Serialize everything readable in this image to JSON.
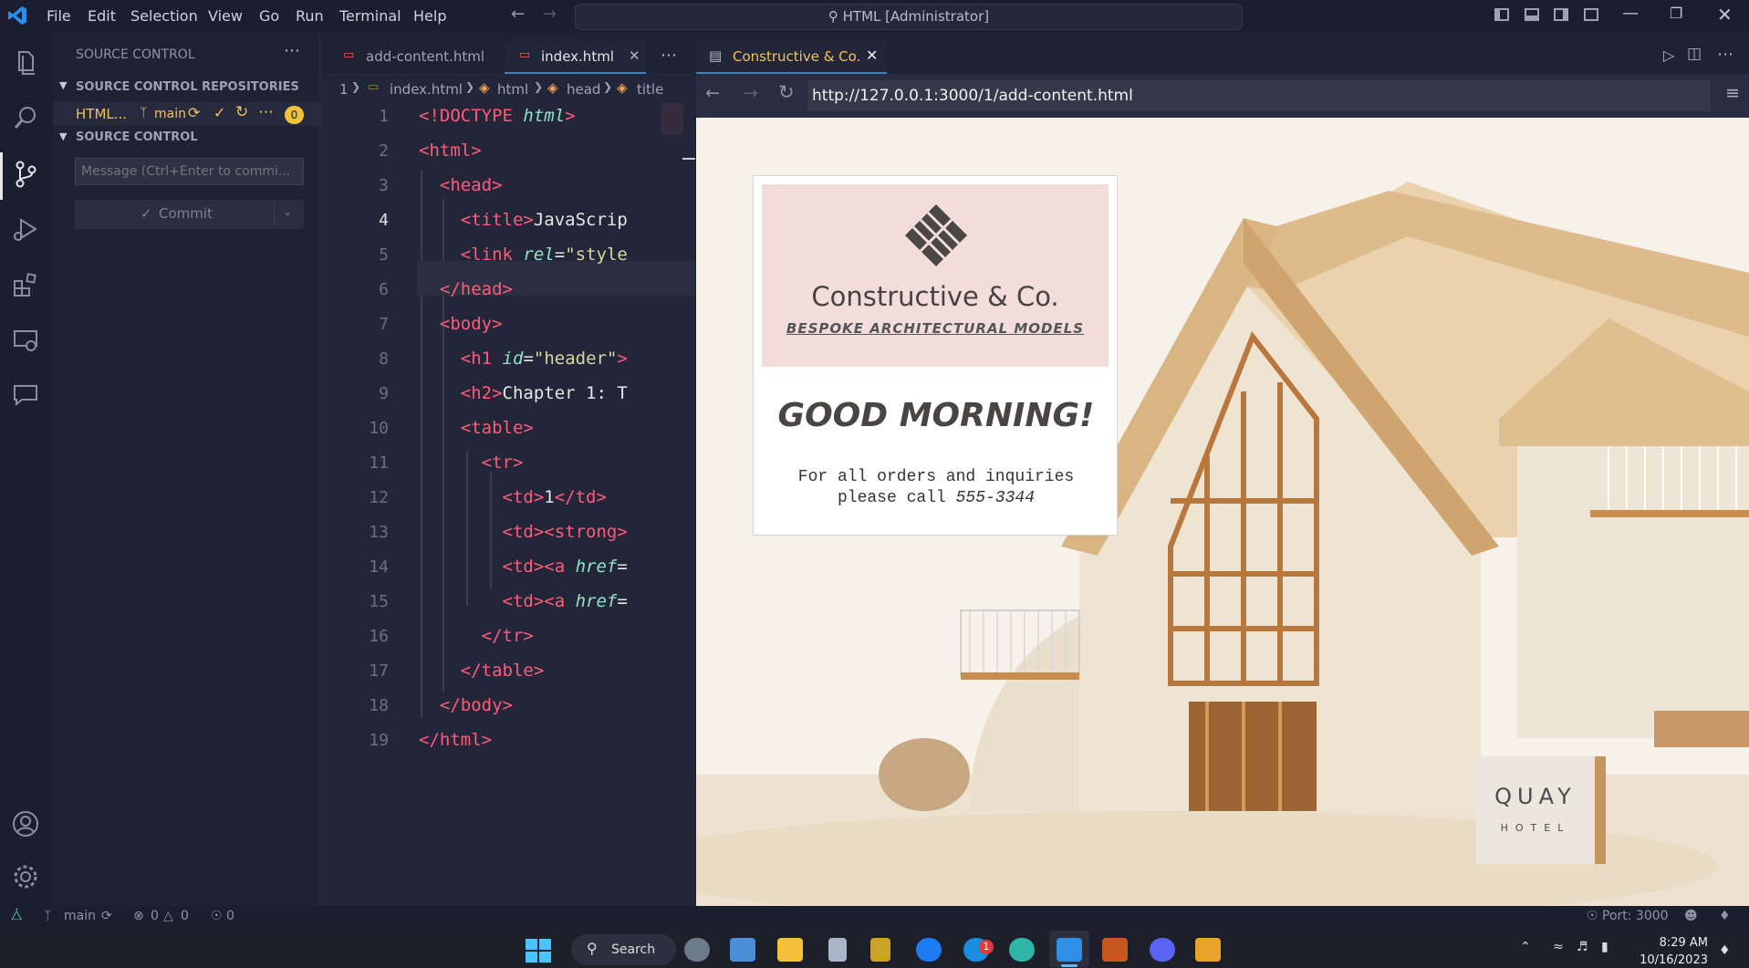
{
  "titlebar": {
    "menu": [
      "File",
      "Edit",
      "Selection",
      "View",
      "Go",
      "Run",
      "Terminal",
      "Help"
    ],
    "search_text": "HTML [Administrator]"
  },
  "sidebar": {
    "header": "SOURCE CONTROL",
    "repos_section": "SOURCE CONTROL REPOSITORIES",
    "repo_name": "HTML...",
    "branch": "main",
    "badge": "0",
    "sc_section": "SOURCE CONTROL",
    "message_placeholder": "Message (Ctrl+Enter to commi...",
    "commit_label": "Commit"
  },
  "editor": {
    "tabs": [
      "add-content.html",
      "index.html"
    ],
    "breadcrumb": [
      "1",
      "index.html",
      "html",
      "head",
      "title"
    ]
  },
  "preview": {
    "tab_label": "Constructive & Co.",
    "url": "http://127.0.0.1:3000/1/add-content.html",
    "brand": "Constructive & Co.",
    "tagline": "BESPOKE ARCHITECTURAL MODELS",
    "greeting": "GOOD MORNING!",
    "info_line1": "For all orders and inquiries",
    "info_line2_prefix": "please call ",
    "phone": "555-3344",
    "sign_line1": "QUAY",
    "sign_line2": "HOTEL"
  },
  "statusbar": {
    "branch": "main",
    "errors": "0",
    "warnings": "0",
    "ports": "0",
    "port_label": "Port: 3000"
  },
  "taskbar": {
    "search_label": "Search",
    "time": "8:29 AM",
    "date": "10/16/2023",
    "skype_badge": "1"
  }
}
